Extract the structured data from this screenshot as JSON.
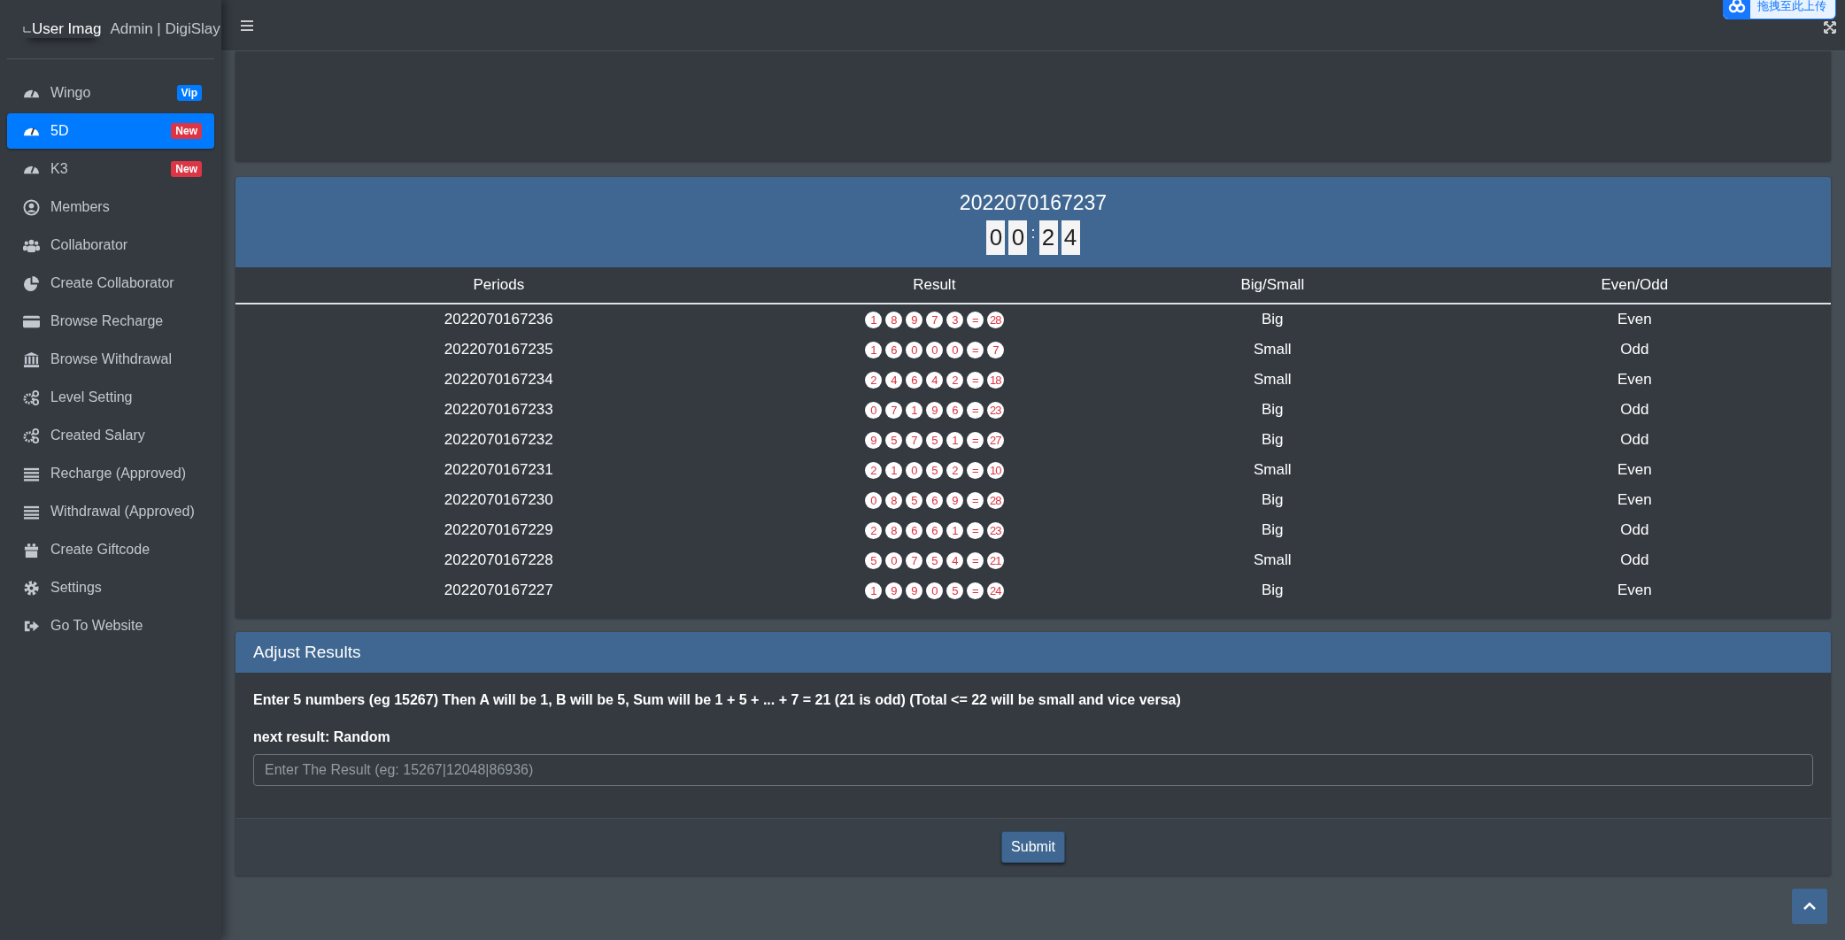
{
  "sidebar": {
    "user_image_alt": "User Imag",
    "user": "Admin | DigiSlay",
    "items": [
      {
        "label": "Wingo",
        "selected": false,
        "badge": {
          "text": "Vip",
          "color": "#007bff"
        }
      },
      {
        "label": "5D",
        "selected": true,
        "badge": {
          "text": "New",
          "color": "#dc3545"
        }
      },
      {
        "label": "K3",
        "selected": false,
        "badge": {
          "text": "New",
          "color": "#dc3545"
        }
      },
      {
        "label": "Members",
        "selected": false
      },
      {
        "label": "Collaborator",
        "selected": false
      },
      {
        "label": "Create Collaborator",
        "selected": false
      },
      {
        "label": "Browse Recharge",
        "selected": false
      },
      {
        "label": "Browse Withdrawal",
        "selected": false
      },
      {
        "label": "Level Setting",
        "selected": false
      },
      {
        "label": "Created Salary",
        "selected": false
      },
      {
        "label": "Recharge (Approved)",
        "selected": false
      },
      {
        "label": "Withdrawal (Approved)",
        "selected": false
      },
      {
        "label": "Create Giftcode",
        "selected": false
      },
      {
        "label": "Settings",
        "selected": false
      },
      {
        "label": "Go To Website",
        "selected": false
      }
    ]
  },
  "upload_button": "拖拽至此上传",
  "game": {
    "period": "2022070167237",
    "timer": {
      "minutes": [
        "0",
        "0"
      ],
      "separator": ":",
      "seconds": [
        "2",
        "4"
      ]
    },
    "columns": [
      "Periods",
      "Result",
      "Big/Small",
      "Even/Odd"
    ],
    "rows": [
      {
        "period": "2022070167236",
        "result": [
          "1",
          "8",
          "9",
          "7",
          "3",
          "=",
          "28"
        ],
        "size": "Big",
        "parity": "Even"
      },
      {
        "period": "2022070167235",
        "result": [
          "1",
          "6",
          "0",
          "0",
          "0",
          "=",
          "7"
        ],
        "size": "Small",
        "parity": "Odd"
      },
      {
        "period": "2022070167234",
        "result": [
          "2",
          "4",
          "6",
          "4",
          "2",
          "=",
          "18"
        ],
        "size": "Small",
        "parity": "Even"
      },
      {
        "period": "2022070167233",
        "result": [
          "0",
          "7",
          "1",
          "9",
          "6",
          "=",
          "23"
        ],
        "size": "Big",
        "parity": "Odd"
      },
      {
        "period": "2022070167232",
        "result": [
          "9",
          "5",
          "7",
          "5",
          "1",
          "=",
          "27"
        ],
        "size": "Big",
        "parity": "Odd"
      },
      {
        "period": "2022070167231",
        "result": [
          "2",
          "1",
          "0",
          "5",
          "2",
          "=",
          "10"
        ],
        "size": "Small",
        "parity": "Even"
      },
      {
        "period": "2022070167230",
        "result": [
          "0",
          "8",
          "5",
          "6",
          "9",
          "=",
          "28"
        ],
        "size": "Big",
        "parity": "Even"
      },
      {
        "period": "2022070167229",
        "result": [
          "2",
          "8",
          "6",
          "6",
          "1",
          "=",
          "23"
        ],
        "size": "Big",
        "parity": "Odd"
      },
      {
        "period": "2022070167228",
        "result": [
          "5",
          "0",
          "7",
          "5",
          "4",
          "=",
          "21"
        ],
        "size": "Small",
        "parity": "Odd"
      },
      {
        "period": "2022070167227",
        "result": [
          "1",
          "9",
          "9",
          "0",
          "5",
          "=",
          "24"
        ],
        "size": "Big",
        "parity": "Even"
      }
    ]
  },
  "adjust": {
    "title": "Adjust Results",
    "instructions": "Enter 5 numbers (eg 15267) Then A will be 1, B will be 5, Sum will be 1 + 5 + ... + 7 = 21 (21 is odd) (Total <= 22 will be small and vice versa)",
    "next_result": "next result: Random",
    "placeholder": "Enter The Result (eg: 15267|12048|86936)",
    "submit": "Submit"
  }
}
